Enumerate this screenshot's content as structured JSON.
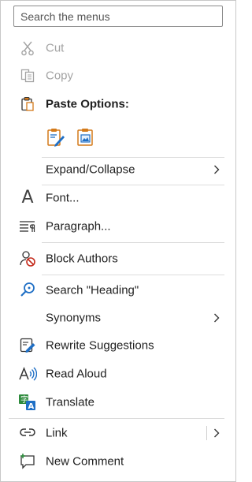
{
  "search": {
    "placeholder": "Search the menus",
    "value": ""
  },
  "menu": {
    "cut": "Cut",
    "copy": "Copy",
    "paste_options": "Paste Options:",
    "expand_collapse": "Expand/Collapse",
    "font": "Font...",
    "paragraph": "Paragraph...",
    "block_authors": "Block Authors",
    "search_heading": "Search \"Heading\"",
    "synonyms": "Synonyms",
    "rewrite_suggestions": "Rewrite Suggestions",
    "read_aloud": "Read Aloud",
    "translate": "Translate",
    "link": "Link",
    "new_comment": "New Comment"
  },
  "icons": {
    "cut": "scissors-icon",
    "copy": "copy-icon",
    "paste": "clipboard-icon",
    "paste_keep_formatting": "paste-keep-formatting-icon",
    "paste_picture": "paste-picture-icon",
    "font": "font-icon",
    "paragraph": "paragraph-icon",
    "block_authors": "block-authors-icon",
    "search": "search-icon",
    "rewrite": "rewrite-icon",
    "read_aloud": "read-aloud-icon",
    "translate": "translate-icon",
    "link": "link-icon",
    "comment": "new-comment-icon",
    "chevron": "chevron-right-icon"
  },
  "colors": {
    "disabled_text": "#a3a3a3",
    "accent_blue": "#1f6fc5",
    "accent_orange": "#d47a1a",
    "accent_red": "#c42b1c",
    "accent_green": "#2e8b3d"
  }
}
